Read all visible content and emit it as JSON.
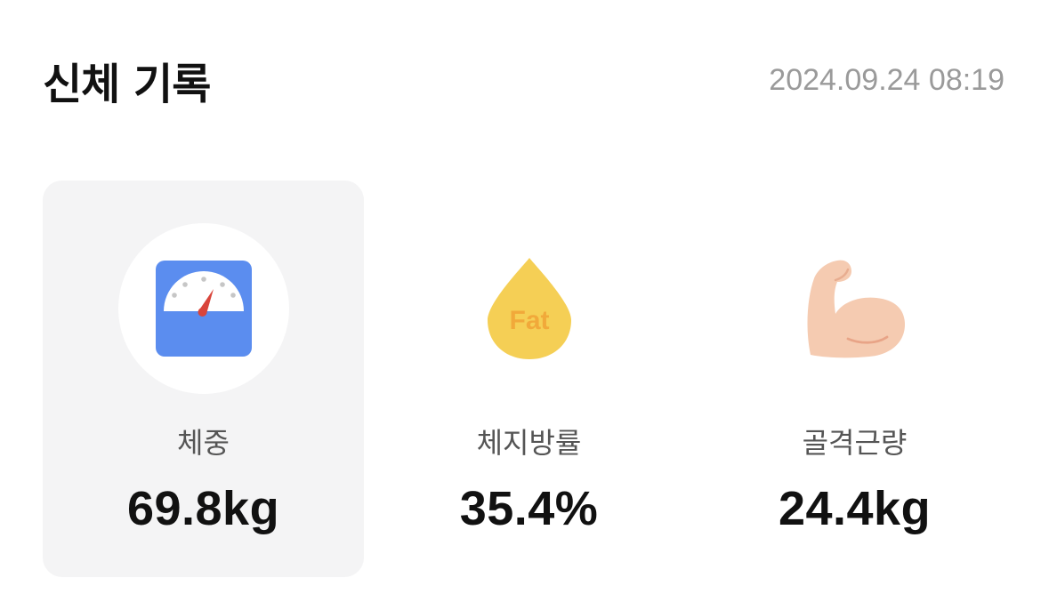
{
  "header": {
    "title": "신체 기록",
    "timestamp": "2024.09.24 08:19"
  },
  "metrics": [
    {
      "label": "체중",
      "value": "69.8kg",
      "icon": "scale-icon",
      "selected": true
    },
    {
      "label": "체지방률",
      "value": "35.4%",
      "icon": "fat-drop-icon",
      "icon_text": "Fat",
      "selected": false
    },
    {
      "label": "골격근량",
      "value": "24.4kg",
      "icon": "flexed-bicep-icon",
      "selected": false
    }
  ],
  "colors": {
    "scale_blue": "#5b8def",
    "needle_red": "#d9453b",
    "fat_yellow": "#f5cf55",
    "fat_text": "#f1a93a",
    "muscle_skin": "#f5cbb1",
    "card_bg": "#f4f4f5"
  }
}
